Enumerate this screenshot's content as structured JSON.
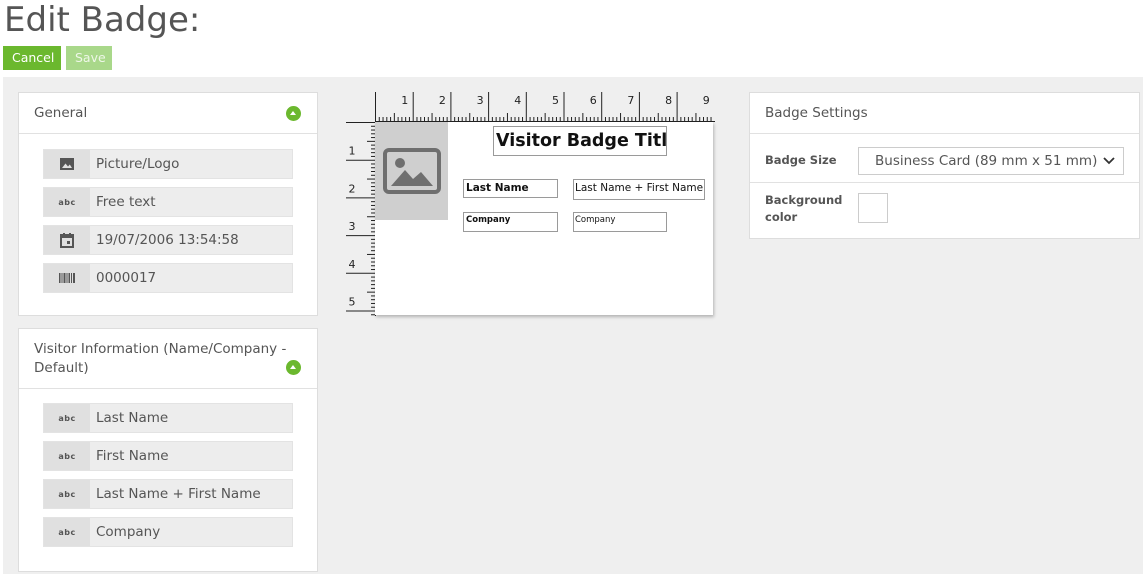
{
  "page": {
    "title": "Edit Badge:"
  },
  "toolbar": {
    "cancel_label": "Cancel",
    "save_label": "Save"
  },
  "general_panel": {
    "title": "General",
    "items": [
      {
        "icon": "image-icon",
        "label": "Picture/Logo"
      },
      {
        "icon": "abc-text-icon",
        "icon_text": "abc",
        "label": "Free text"
      },
      {
        "icon": "calendar-icon",
        "label": "19/07/2006 13:54:58"
      },
      {
        "icon": "barcode-icon",
        "label": "0000017"
      }
    ]
  },
  "visitor_panel": {
    "title": "Visitor Information (Name/Company - Default)",
    "items": [
      {
        "icon": "abc-text-icon",
        "icon_text": "abc",
        "label": "Last Name"
      },
      {
        "icon": "abc-text-icon",
        "icon_text": "abc",
        "label": "First Name"
      },
      {
        "icon": "abc-text-icon",
        "icon_text": "abc",
        "label": "Last Name + First Name"
      },
      {
        "icon": "abc-text-icon",
        "icon_text": "abc",
        "label": "Company"
      }
    ]
  },
  "badge": {
    "title": "Visitor Badge Title",
    "last_name_label": "Last Name",
    "full_name_value": "Last Name + First Name",
    "company_label": "Company",
    "company_value": "Company",
    "ruler_top": [
      "1",
      "2",
      "3",
      "4",
      "5",
      "6",
      "7",
      "8",
      "9"
    ],
    "ruler_left": [
      "1",
      "2",
      "3",
      "4",
      "5"
    ]
  },
  "settings_panel": {
    "title": "Badge Settings",
    "badge_size_label": "Badge Size",
    "badge_size_value": "Business Card (89 mm x 51 mm)",
    "background_color_label": "Background color",
    "background_color_value": "#ffffff"
  },
  "colors": {
    "accent": "#6bb82e",
    "accent_disabled": "#a9d88a",
    "workspace_bg": "#efefef"
  }
}
